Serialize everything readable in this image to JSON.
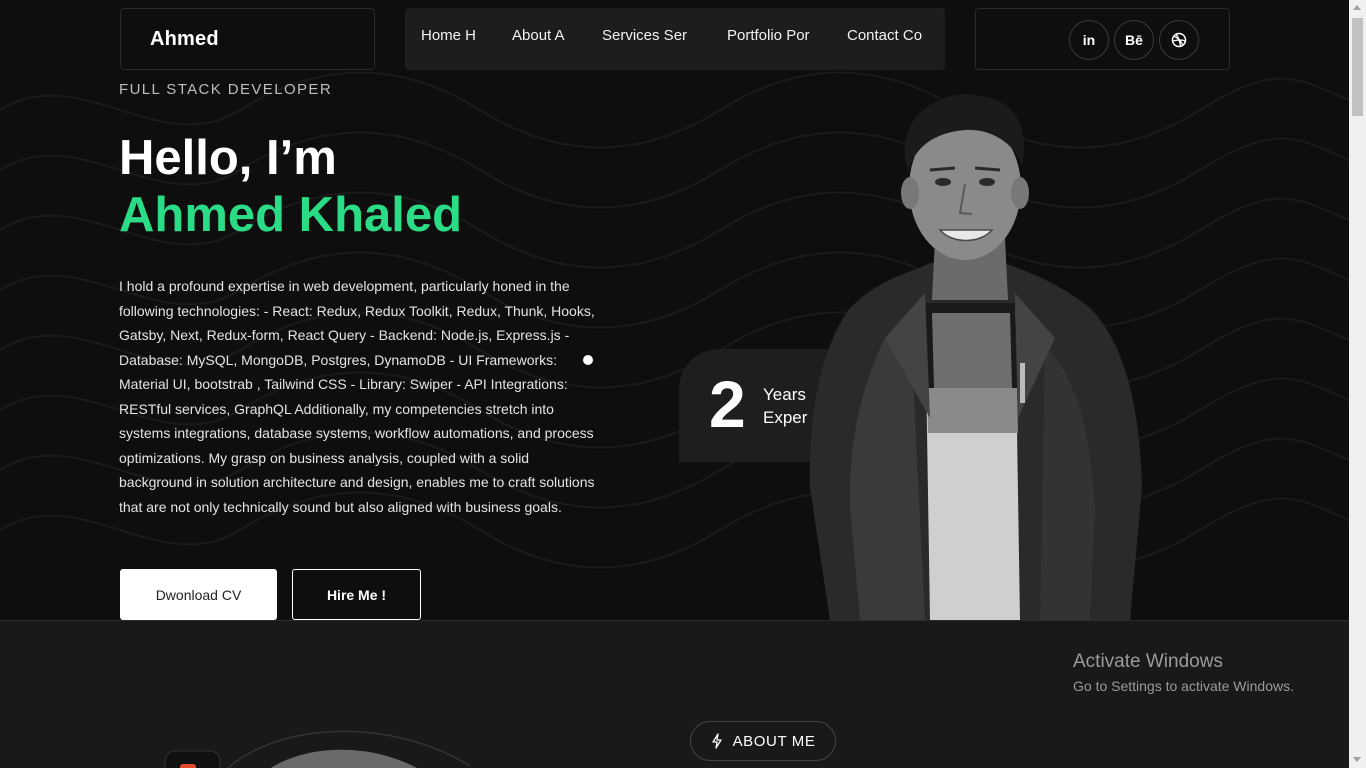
{
  "header": {
    "logo": "Ahmed",
    "nav": [
      "Home H",
      "About A",
      "Services Ser",
      "Portfolio Por",
      "Contact Co"
    ],
    "socials": [
      {
        "icon": "linkedin-icon",
        "glyph": "in"
      },
      {
        "icon": "behance-icon",
        "glyph": "Bē"
      },
      {
        "icon": "dribbble-icon",
        "glyph": ""
      }
    ]
  },
  "hero": {
    "role": "FULL STACK DEVELOPER",
    "greeting": "Hello, I’m",
    "name": "Ahmed Khaled",
    "bio": "I hold a profound expertise in web development, particularly honed in the following technologies: - React: Redux, Redux Toolkit, Redux, Thunk, Hooks, Gatsby, Next, Redux-form, React Query - Backend: Node.js, Express.js - Database: MySQL, MongoDB, Postgres, DynamoDB - UI Frameworks: Material UI, bootstrab , Tailwind CSS - Library: Swiper - API Integrations: RESTful services, GraphQL Additionally, my competencies stretch into systems integrations, database systems, workflow automations, and process optimizations. My grasp on business analysis, coupled with a solid background in solution architecture and design, enables me to craft solutions that are not only technically sound but also aligned with business goals.",
    "download_cv": "Dwonload CV",
    "hire_me": "Hire Me !",
    "experience": {
      "number": "2",
      "line1": "Years",
      "line2": "Exper"
    }
  },
  "about": {
    "label": "ABOUT ME"
  },
  "activate_windows": {
    "title": "Activate Windows",
    "subtitle": "Go to Settings to activate Windows."
  },
  "colors": {
    "accent": "#2bdc86",
    "background": "#0e0e0f",
    "panel": "#1d1d1f"
  }
}
